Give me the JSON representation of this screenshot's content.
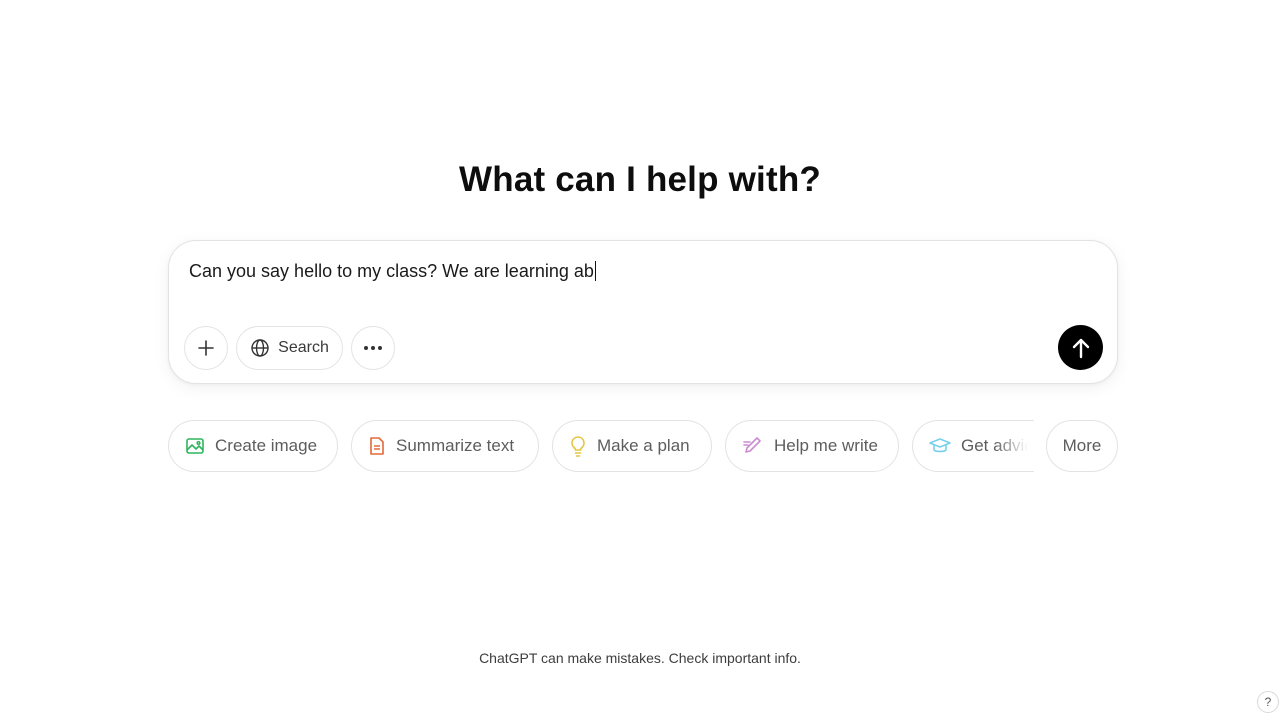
{
  "main": {
    "headline": "What can I help with?"
  },
  "composer": {
    "input_value": "Can you say hello to my class? We are learning ab",
    "search_label": "Search",
    "plus_icon": "plus-icon",
    "more_icon": "ellipsis-icon",
    "send_icon": "arrow-up-icon"
  },
  "suggestions": [
    {
      "label": "Create image",
      "icon": "image-icon",
      "color": "#2fb55d"
    },
    {
      "label": "Summarize text",
      "icon": "document-icon",
      "color": "#e3683a"
    },
    {
      "label": "Make a plan",
      "icon": "lightbulb-icon",
      "color": "#e2c541"
    },
    {
      "label": "Help me write",
      "icon": "pen-icon",
      "color": "#cb8bd0"
    },
    {
      "label": "Get advic",
      "icon": "graduation-cap-icon",
      "color": "#76d0eb"
    },
    {
      "label": "More"
    }
  ],
  "footer": {
    "disclaimer": "ChatGPT can make mistakes. Check important info.",
    "help_label": "?"
  }
}
